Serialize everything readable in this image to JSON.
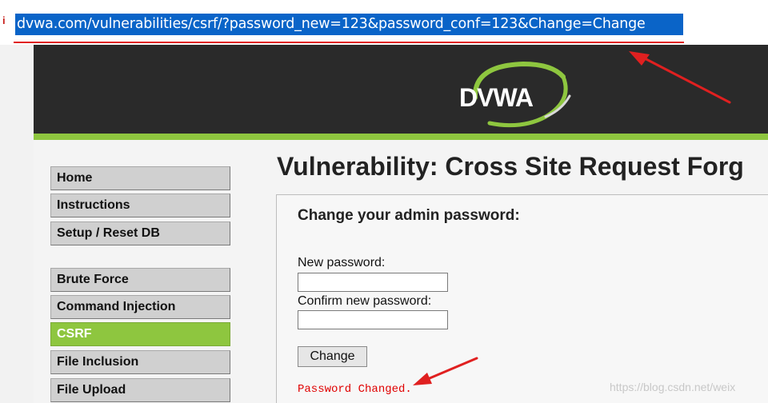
{
  "browser": {
    "url": "dvwa.com/vulnerabilities/csrf/?password_new=123&password_conf=123&Change=Change"
  },
  "header": {
    "logo_text": "DVWA"
  },
  "sidebar": {
    "items": [
      {
        "label": "Home"
      },
      {
        "label": "Instructions"
      },
      {
        "label": "Setup / Reset DB"
      },
      {
        "label": "Brute Force"
      },
      {
        "label": "Command Injection"
      },
      {
        "label": "CSRF",
        "active": true
      },
      {
        "label": "File Inclusion"
      },
      {
        "label": "File Upload"
      }
    ]
  },
  "main": {
    "title": "Vulnerability: Cross Site Request Forg",
    "form_title": "Change your admin password:",
    "new_password_label": "New password:",
    "confirm_password_label": "Confirm new password:",
    "new_password_value": "",
    "confirm_password_value": "",
    "change_button": "Change",
    "status_message": "Password Changed."
  },
  "watermark": "https://blog.csdn.net/weix",
  "colors": {
    "accent": "#8ec63f",
    "header_bg": "#2a2a2a",
    "annotation": "#e02020",
    "url_selection": "#0a64c8"
  }
}
